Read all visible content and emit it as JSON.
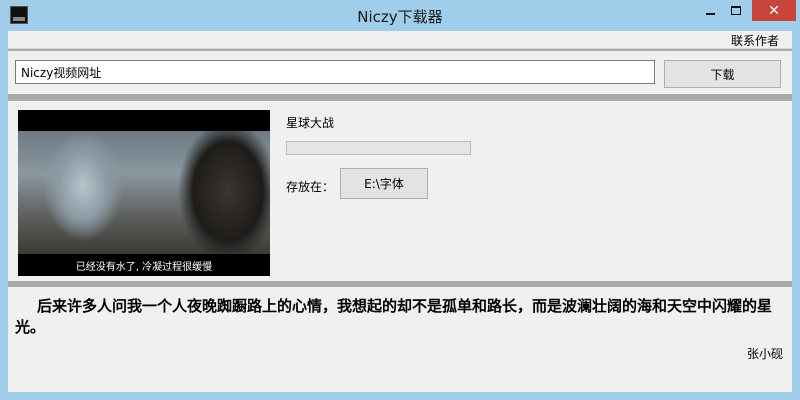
{
  "window": {
    "title": "Niczy下载器",
    "controls": {
      "minimize": "minimize",
      "maximize": "maximize",
      "close": "✕"
    }
  },
  "menu": {
    "contact_author": "联系作者"
  },
  "url_panel": {
    "input_value": "Niczy视频网址",
    "download_label": "下载"
  },
  "video": {
    "title": "星球大战",
    "thumbnail_caption": "已经没有水了, 冷凝过程很缓慢",
    "progress": 0,
    "save_label": "存放在：",
    "save_path": "E:\\字体"
  },
  "quote": {
    "text": "后来许多人问我一个人夜晚踟蹰路上的心情，我想起的却不是孤单和路长，而是波澜壮阔的海和天空中闪耀的星光。",
    "author": "张小砚"
  }
}
